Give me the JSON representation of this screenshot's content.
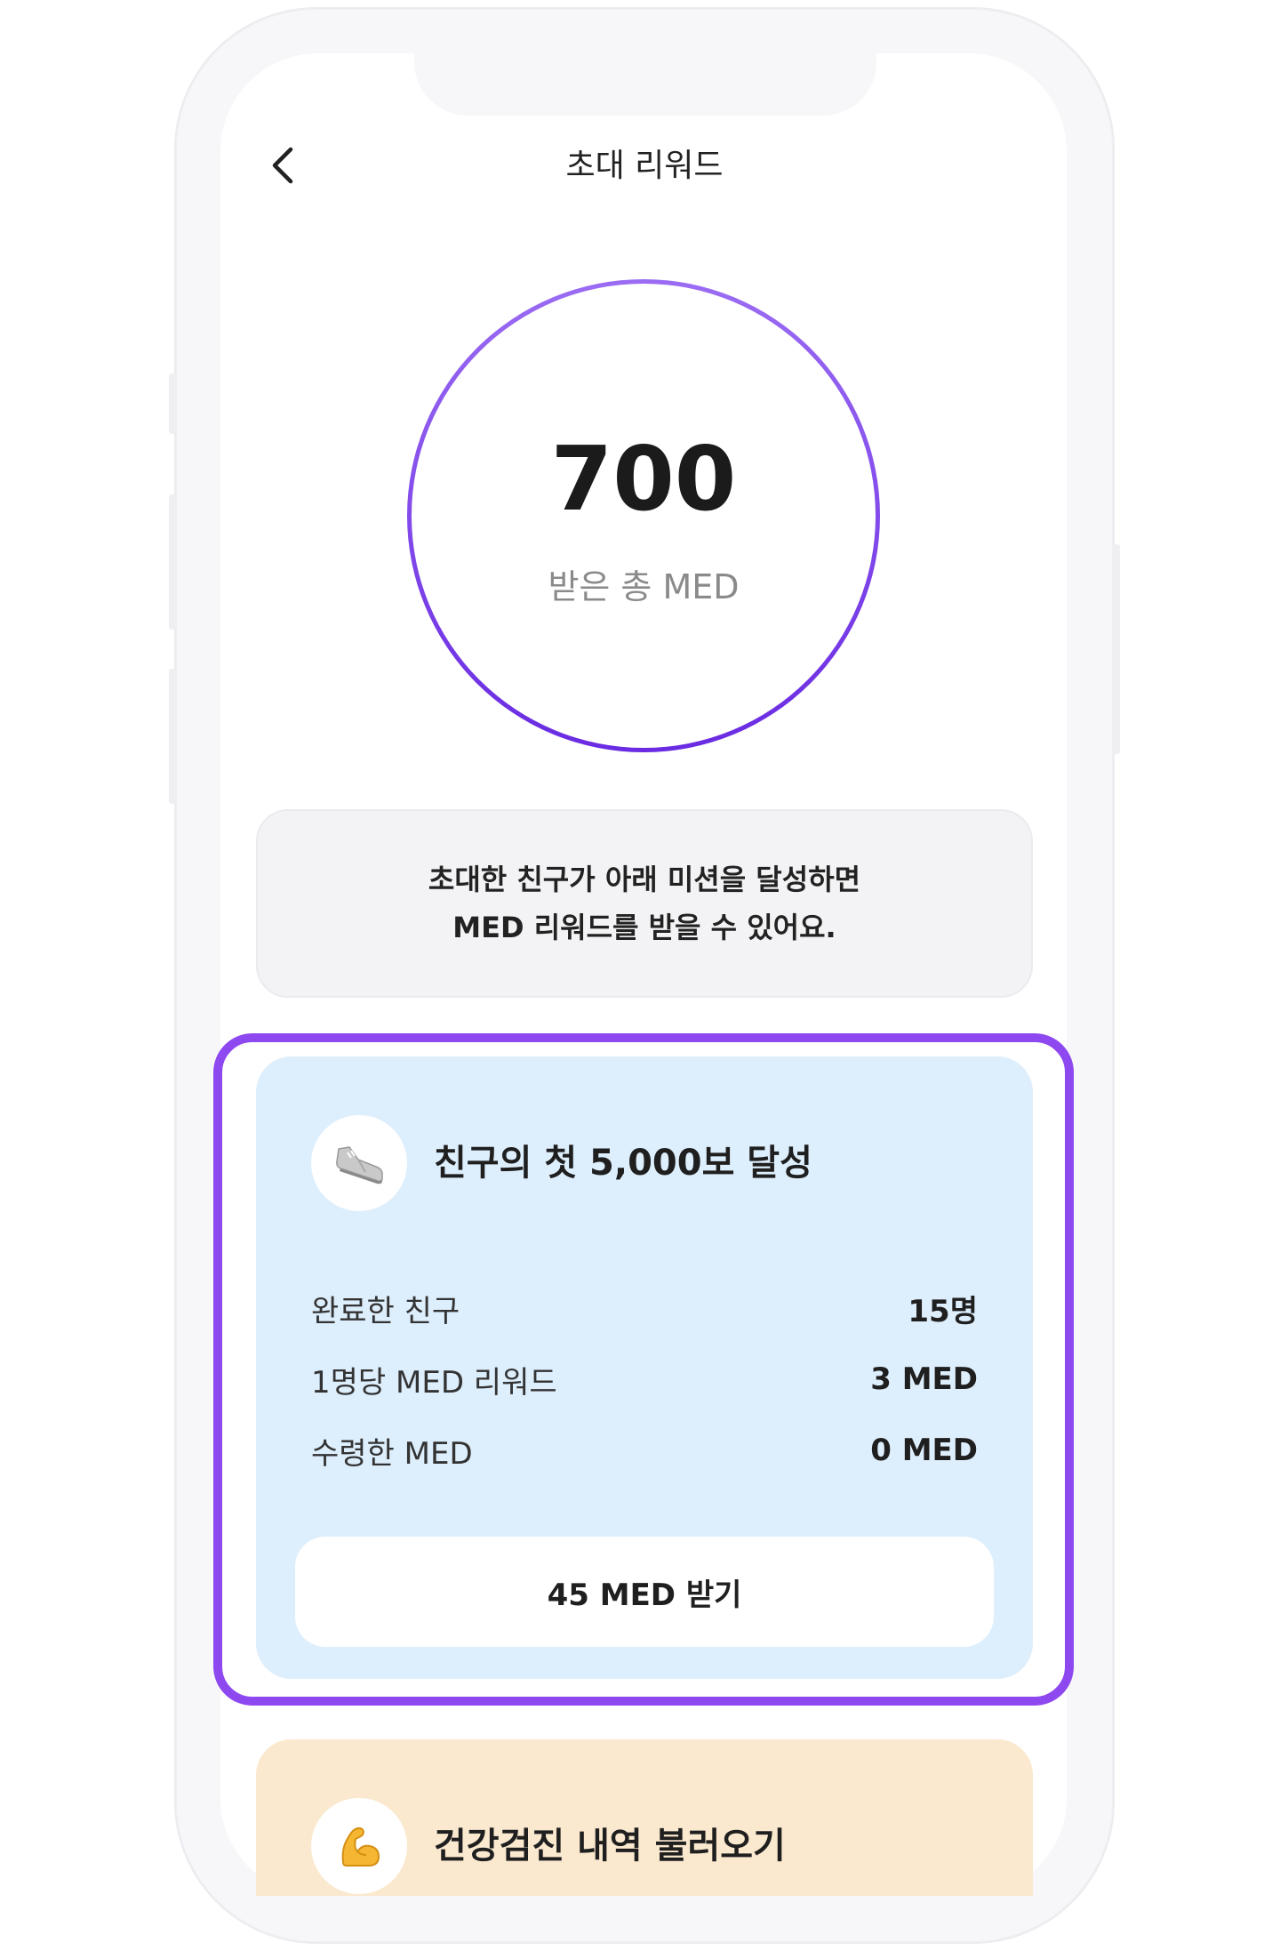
{
  "header": {
    "title": "초대 리워드"
  },
  "summary": {
    "total_value": "700",
    "total_label": "받은 총 MED"
  },
  "info": {
    "line1": "초대한 친구가 아래 미션을 달성하면",
    "line2": "MED 리워드를 받을 수 있어요."
  },
  "missions": [
    {
      "icon": "sneaker-icon",
      "title": "친구의 첫 5,000보 달성",
      "stats": [
        {
          "label": "완료한 친구",
          "value": "15명"
        },
        {
          "label": "1명당 MED 리워드",
          "value": "3 MED"
        },
        {
          "label": "수령한 MED",
          "value": "0 MED"
        }
      ],
      "button_label": "45 MED 받기",
      "background": "#ddeefc"
    },
    {
      "icon": "flexed-biceps-icon",
      "title": "건강검진 내역 불러오기",
      "background": "#fbe9cf"
    }
  ],
  "colors": {
    "accent": "#8e48f0",
    "ring_gradient_top": "#9b6cf3",
    "ring_gradient_bottom": "#6a2be2"
  }
}
